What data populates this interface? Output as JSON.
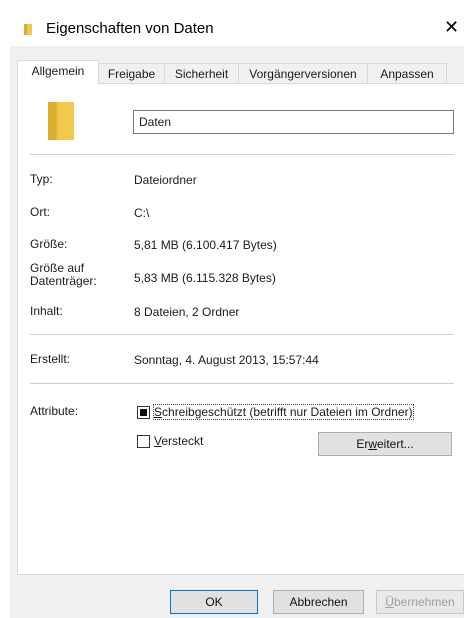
{
  "window": {
    "title": "Eigenschaften von Daten",
    "close": "✕"
  },
  "tabs": [
    {
      "label": "Allgemein"
    },
    {
      "label": "Freigabe"
    },
    {
      "label": "Sicherheit"
    },
    {
      "label": "Vorgängerversionen"
    },
    {
      "label": "Anpassen"
    }
  ],
  "general": {
    "name": "Daten",
    "props": [
      {
        "label": "Typ:",
        "value": "Dateiordner"
      },
      {
        "label": "Ort:",
        "value": "C:\\"
      },
      {
        "label": "Größe:",
        "value": "5,81 MB (6.100.417 Bytes)"
      },
      {
        "label": "Größe auf Datenträger:",
        "value": "5,83 MB (6.115.328 Bytes)"
      },
      {
        "label": "Inhalt:",
        "value": "8 Dateien, 2 Ordner"
      }
    ],
    "created_label": "Erstellt:",
    "created_value": "Sonntag, 4. August 2013, 15:57:44",
    "attributes_label": "Attribute:",
    "readonly": {
      "ul": "S",
      "rest": "chreibgeschützt (betrifft nur Dateien im Ordner)",
      "state": "indeterminate"
    },
    "hidden": {
      "ul": "V",
      "rest": "ersteckt",
      "state": "unchecked"
    },
    "advanced": {
      "pre": "Er",
      "ul": "w",
      "post": "eitert..."
    }
  },
  "buttons": {
    "ok": "OK",
    "cancel": "Abbrechen",
    "apply_ul": "Ü",
    "apply_rest": "bernehmen"
  },
  "colors": {
    "folder": "#f2c94c",
    "folder_dark": "#dcae2e",
    "accent": "#0078d7"
  }
}
